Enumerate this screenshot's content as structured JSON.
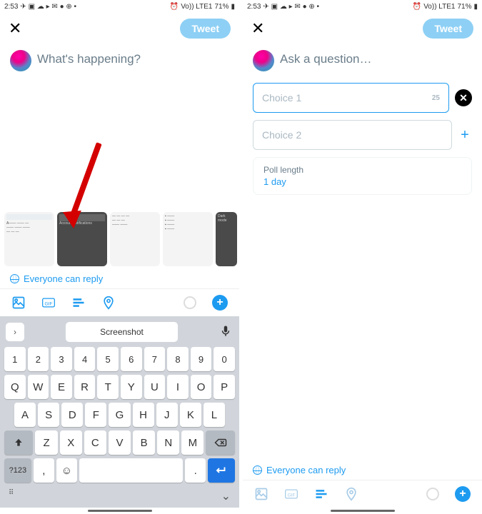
{
  "status": {
    "time": "2:53",
    "batt": "71%",
    "net": "Vo)) LTE1"
  },
  "header": {
    "tweet_label": "Tweet"
  },
  "left": {
    "placeholder": "What's happening?",
    "reply": "Everyone can reply",
    "gallery": [
      "",
      "Account notifications",
      "",
      "",
      "Dark mode"
    ],
    "keyboard": {
      "suggestion": "Screenshot",
      "nums": [
        "1",
        "2",
        "3",
        "4",
        "5",
        "6",
        "7",
        "8",
        "9",
        "0"
      ],
      "r1": [
        "Q",
        "W",
        "E",
        "R",
        "T",
        "Y",
        "U",
        "I",
        "O",
        "P"
      ],
      "r2": [
        "A",
        "S",
        "D",
        "F",
        "G",
        "H",
        "J",
        "K",
        "L"
      ],
      "r3": [
        "Z",
        "X",
        "C",
        "V",
        "B",
        "N",
        "M"
      ],
      "fn": "?123",
      "comma": ",",
      "dot": "."
    }
  },
  "right": {
    "placeholder": "Ask a question…",
    "choice1": "Choice 1",
    "choice1_count": "25",
    "choice2": "Choice 2",
    "poll_len_label": "Poll length",
    "poll_len_value": "1 day",
    "reply": "Everyone can reply"
  }
}
